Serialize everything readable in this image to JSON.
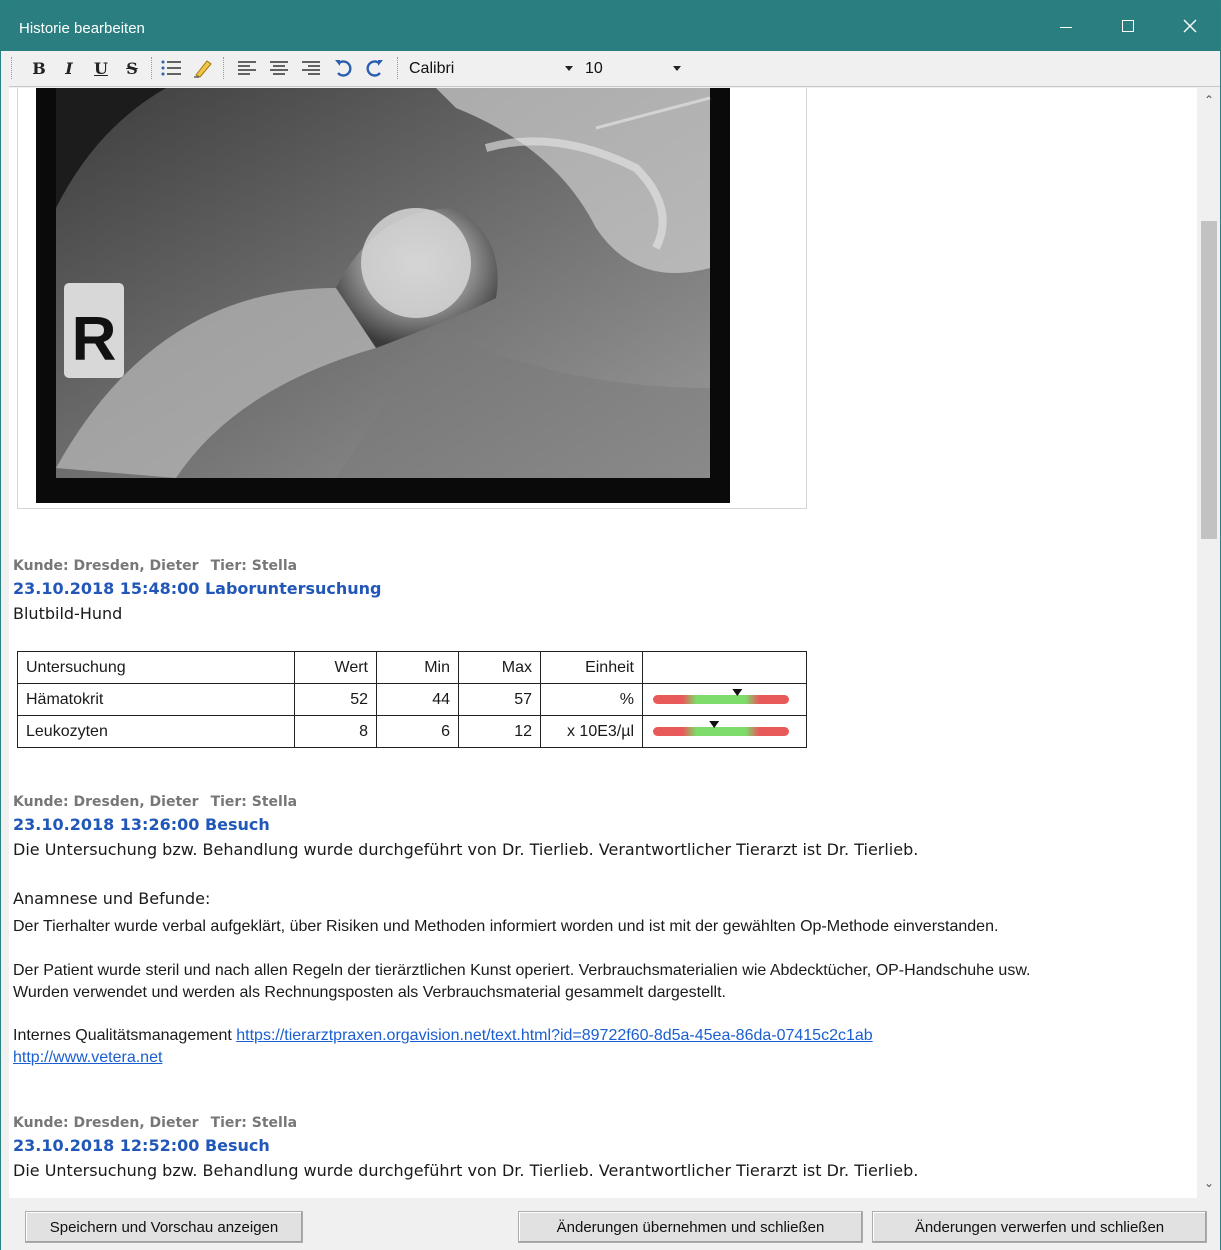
{
  "window": {
    "title": "Historie bearbeiten"
  },
  "toolbar": {
    "bold_label": "B",
    "italic_label": "I",
    "underline_label": "U",
    "strike_label": "S",
    "font_family": "Calibri",
    "font_size": "10"
  },
  "entries": [
    {
      "meta_customer": "Kunde: Dresden, Dieter",
      "meta_animal": "Tier: Stella",
      "heading": "23.10.2018 15:48:00 Laboruntersuchung",
      "subtitle": "Blutbild-Hund",
      "table": {
        "headers": [
          "Untersuchung",
          "Wert",
          "Min",
          "Max",
          "Einheit",
          ""
        ],
        "rows": [
          {
            "name": "Hämatokrit",
            "value": "52",
            "min": "44",
            "max": "57",
            "unit": "%",
            "level": 0.62
          },
          {
            "name": "Leukozyten",
            "value": "8",
            "min": "6",
            "max": "12",
            "unit": "x 10E3/µl",
            "level": 0.45
          }
        ]
      }
    },
    {
      "meta_customer": "Kunde: Dresden, Dieter",
      "meta_animal": "Tier: Stella",
      "heading": "23.10.2018 13:26:00 Besuch",
      "line1": "Die Untersuchung bzw. Behandlung wurde durchgeführt von Dr. Tierlieb.  Verantwortlicher Tierarzt ist Dr. Tierlieb.",
      "section_title": "Anamnese und Befunde:",
      "para1": "Der Tierhalter wurde verbal aufgeklärt, über Risiken und Methoden informiert worden und ist mit der gewählten Op-Methode einverstanden.",
      "para2a": "Der Patient wurde steril und nach allen Regeln der tierärztlichen Kunst operiert. Verbrauchsmaterialien wie Abdecktücher, OP-Handschuhe usw.",
      "para2b": "Wurden verwendet und werden als Rechnungsposten als Verbrauchsmaterial gesammelt dargestellt.",
      "qm_label": "Internes Qualitätsmanagement",
      "qm_link": "https://tierarztpraxen.orgavision.net/text.html?id=89722f60-8d5a-45ea-86da-07415c2c1ab",
      "web_link": "http://www.vetera.net"
    },
    {
      "meta_customer": "Kunde: Dresden, Dieter",
      "meta_animal": "Tier: Stella",
      "heading": "23.10.2018 12:52:00 Besuch",
      "line1": "Die Untersuchung bzw. Behandlung wurde durchgeführt von Dr. Tierlieb.  Verantwortlicher Tierarzt ist Dr. Tierlieb."
    }
  ],
  "xray_marker": "R",
  "buttons": {
    "save_preview": "Speichern und Vorschau anzeigen",
    "apply_close": "Änderungen übernehmen und schließen",
    "discard_close": "Änderungen verwerfen und schließen"
  },
  "colors": {
    "titlebar": "#2b7e80",
    "heading_blue": "#2157b8",
    "link_blue": "#1a5fd0"
  }
}
